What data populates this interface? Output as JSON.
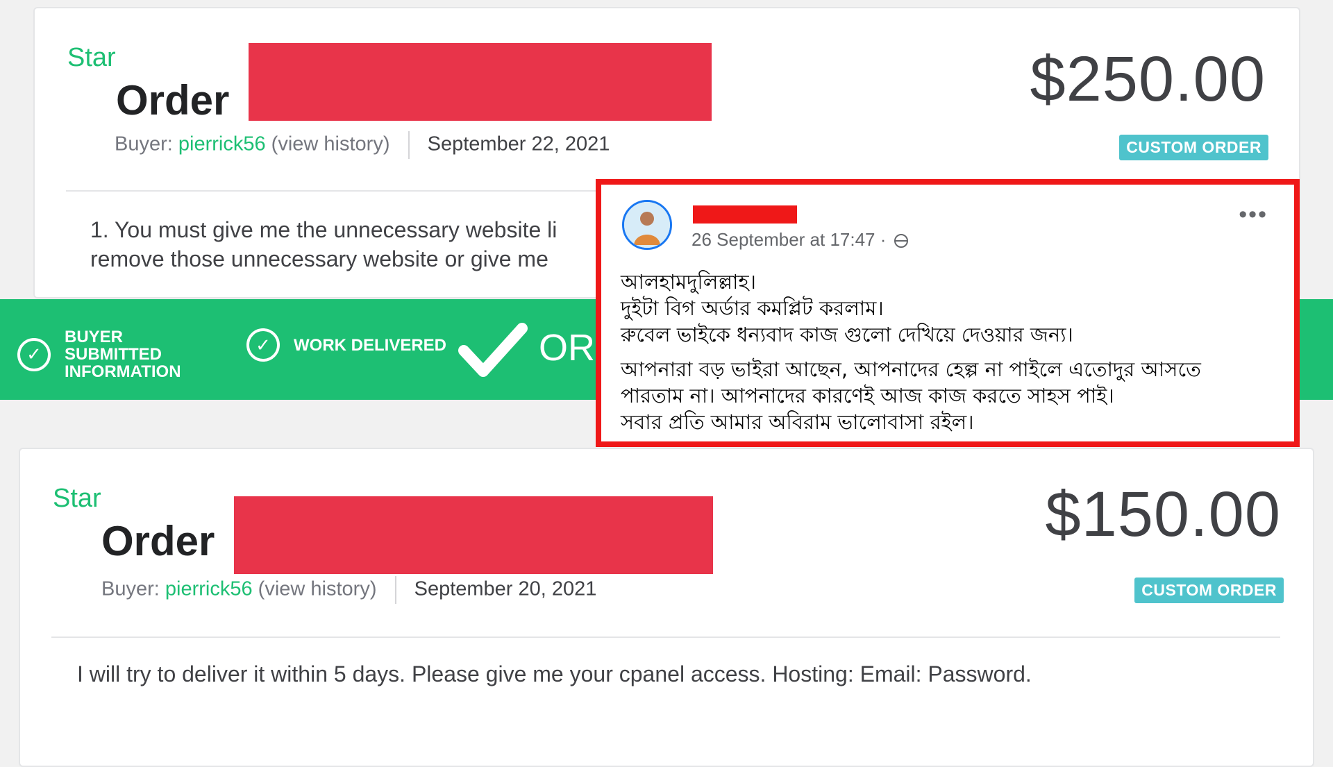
{
  "order1": {
    "star_label": "Star",
    "title": "Order",
    "buyer_prefix": "Buyer:",
    "buyer_name": "pierrick56",
    "view_history": "(view history)",
    "date": "September 22, 2021",
    "price": "$250.00",
    "badge": "CUSTOM ORDER",
    "message_line1": "1. You must give me the unnecessary website li",
    "message_line2": "remove those unnecessary website or give me"
  },
  "status": {
    "step1_label": "BUYER SUBMITTED INFORMATION",
    "step2_label": "WORK DELIVERED",
    "final_label": "OR",
    "check_glyph": "✓"
  },
  "fb_post": {
    "timestamp": "26 September at 17:47 ·",
    "more": "•••",
    "lines": [
      "আলহামদুলিল্লাহ।",
      " দুইটা বিগ অর্ডার কমপ্লিট করলাম।",
      "রুবেল ভাইকে ধন্যবাদ কাজ গুলো দেখিয়ে দেওয়ার জন্য।",
      "আপনারা  বড় ভাইরা আছেন,  আপনাদের হেল্প না পাইলে এতোদুর আসতে",
      "পারতাম না।   আপনাদের কারণেই আজ কাজ করতে সাহস পাই।",
      "সবার প্রতি আমার অবিরাম  ভালোবাসা রইল।"
    ]
  },
  "order2": {
    "star_label": "Star",
    "title": "Order",
    "buyer_prefix": "Buyer:",
    "buyer_name": "pierrick56",
    "view_history": "(view history)",
    "date": "September 20, 2021",
    "price": "$150.00",
    "badge": "CUSTOM ORDER",
    "message": "I will try to deliver it within 5 days. Please give me your cpanel access. Hosting: Email: Password."
  },
  "colors": {
    "brand_green": "#1dbf73",
    "redaction_red": "#e8344a",
    "highlight_border": "#ef1818",
    "badge_teal": "#4fc3cc"
  }
}
